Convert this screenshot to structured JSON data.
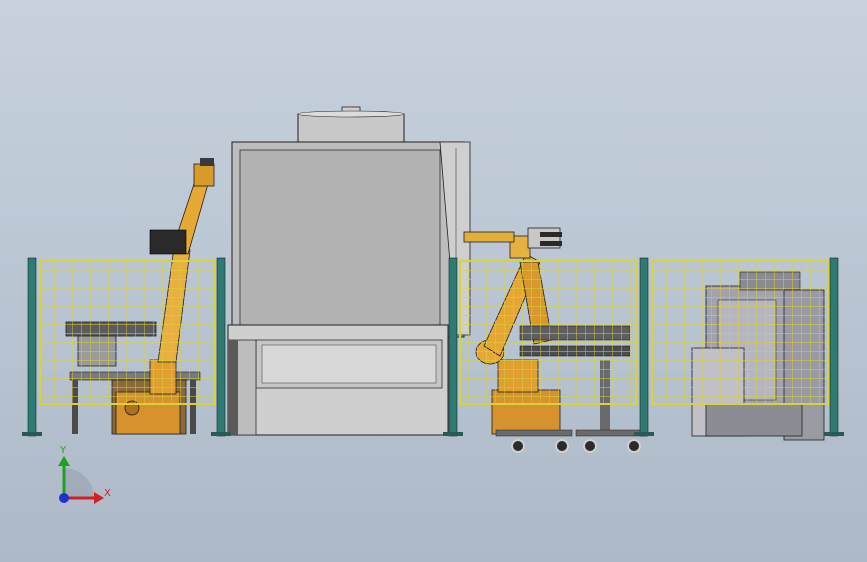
{
  "view": {
    "type": "cad-assembly-front-view",
    "background_top": "#c8d2de",
    "background_bottom": "#aeb9c8"
  },
  "colors": {
    "fence_post": "#2f7a72",
    "fence_mesh": "#d9d23a",
    "robot_orange": "#e0a030",
    "robot_dark": "#2a2a2a",
    "machine_gray": "#b4b4b4",
    "machine_light": "#d6d6d6",
    "outline": "#202020"
  },
  "triad": {
    "x_label": "X",
    "y_label": "Y",
    "x_color": "#d22020",
    "y_color": "#20a020",
    "z_color": "#2030d0"
  }
}
